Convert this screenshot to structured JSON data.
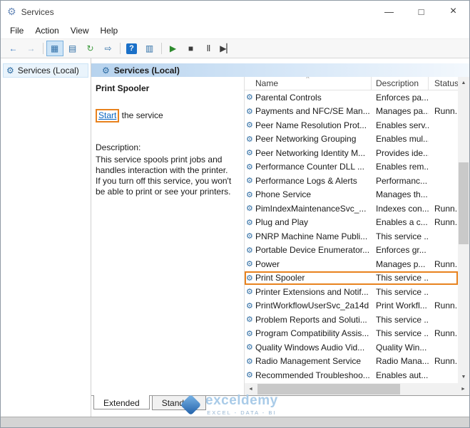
{
  "window": {
    "title": "Services",
    "controls": {
      "minimize": "—",
      "maximize": "□",
      "close": "×"
    }
  },
  "menu": {
    "items": [
      "File",
      "Action",
      "View",
      "Help"
    ]
  },
  "toolbar": {
    "items": [
      {
        "name": "back",
        "glyph": "←",
        "color": "#2c6fbb"
      },
      {
        "name": "forward",
        "glyph": "→",
        "color": "#9fb8cf"
      },
      {
        "sep": true
      },
      {
        "name": "show-console-tree",
        "glyph": "▦",
        "color": "#2f6fa7",
        "active": true
      },
      {
        "name": "properties",
        "glyph": "▤",
        "color": "#2f6fa7"
      },
      {
        "name": "refresh",
        "glyph": "↻",
        "color": "#3f9c3f"
      },
      {
        "name": "export-list",
        "glyph": "⇨",
        "color": "#2f6fa7"
      },
      {
        "sep": true
      },
      {
        "name": "help",
        "glyph": "?",
        "help": true
      },
      {
        "name": "extended-view",
        "glyph": "▥",
        "color": "#2f6fa7"
      },
      {
        "sep": true
      },
      {
        "name": "start-service",
        "glyph": "▶",
        "color": "#2e8b2e"
      },
      {
        "name": "stop-service",
        "glyph": "■",
        "color": "#3c3c3c"
      },
      {
        "name": "pause-service",
        "glyph": "Ⅱ",
        "color": "#3c3c3c"
      },
      {
        "name": "restart-service",
        "glyph": "▶▏",
        "color": "#3c3c3c"
      }
    ]
  },
  "tree": {
    "root_label": "Services (Local)"
  },
  "main": {
    "header": "Services (Local)",
    "pane": {
      "title": "Print Spooler",
      "action_link": "Start",
      "action_suffix": " the service",
      "description_label": "Description:",
      "description": "This service spools print jobs and handles interaction with the printer. If you turn off this service, you won't be able to print or see your printers."
    }
  },
  "table": {
    "columns": [
      "Name",
      "Description",
      "Status"
    ],
    "sort_indicator": "^",
    "rows": [
      {
        "name": "Parental Controls",
        "description": "Enforces pa...",
        "status": ""
      },
      {
        "name": "Payments and NFC/SE Man...",
        "description": "Manages pa...",
        "status": "Runn..."
      },
      {
        "name": "Peer Name Resolution Prot...",
        "description": "Enables serv...",
        "status": ""
      },
      {
        "name": "Peer Networking Grouping",
        "description": "Enables mul...",
        "status": ""
      },
      {
        "name": "Peer Networking Identity M...",
        "description": "Provides ide...",
        "status": ""
      },
      {
        "name": "Performance Counter DLL ...",
        "description": "Enables rem...",
        "status": ""
      },
      {
        "name": "Performance Logs & Alerts",
        "description": "Performanc...",
        "status": ""
      },
      {
        "name": "Phone Service",
        "description": "Manages th...",
        "status": ""
      },
      {
        "name": "PimIndexMaintenanceSvc_...",
        "description": "Indexes con...",
        "status": "Runn..."
      },
      {
        "name": "Plug and Play",
        "description": "Enables a c...",
        "status": "Runn..."
      },
      {
        "name": "PNRP Machine Name Publi...",
        "description": "This service ...",
        "status": ""
      },
      {
        "name": "Portable Device Enumerator...",
        "description": "Enforces gr...",
        "status": ""
      },
      {
        "name": "Power",
        "description": "Manages p...",
        "status": "Runn..."
      },
      {
        "name": "Print Spooler",
        "description": "This service ...",
        "status": "",
        "highlight": true
      },
      {
        "name": "Printer Extensions and Notif...",
        "description": "This service ...",
        "status": ""
      },
      {
        "name": "PrintWorkflowUserSvc_2a14d",
        "description": "Print Workfl...",
        "status": "Runn..."
      },
      {
        "name": "Problem Reports and Soluti...",
        "description": "This service ...",
        "status": ""
      },
      {
        "name": "Program Compatibility Assis...",
        "description": "This service ...",
        "status": "Runn..."
      },
      {
        "name": "Quality Windows Audio Vid...",
        "description": "Quality Win...",
        "status": ""
      },
      {
        "name": "Radio Management Service",
        "description": "Radio Mana...",
        "status": "Runn..."
      },
      {
        "name": "Recommended Troubleshoo...",
        "description": "Enables aut...",
        "status": ""
      }
    ]
  },
  "tabs": [
    {
      "label": "Extended",
      "active": true
    },
    {
      "label": "Standard"
    }
  ],
  "watermark": {
    "brand": "exceldemy",
    "tagline": "EXCEL - DATA - BI"
  },
  "icons": {
    "gear": "⚙",
    "scroll_up": "▲",
    "scroll_down": "▼",
    "scroll_left": "◄",
    "scroll_right": "►"
  },
  "colors": {
    "annotation": "#E8821E",
    "link": "#0563C1"
  }
}
